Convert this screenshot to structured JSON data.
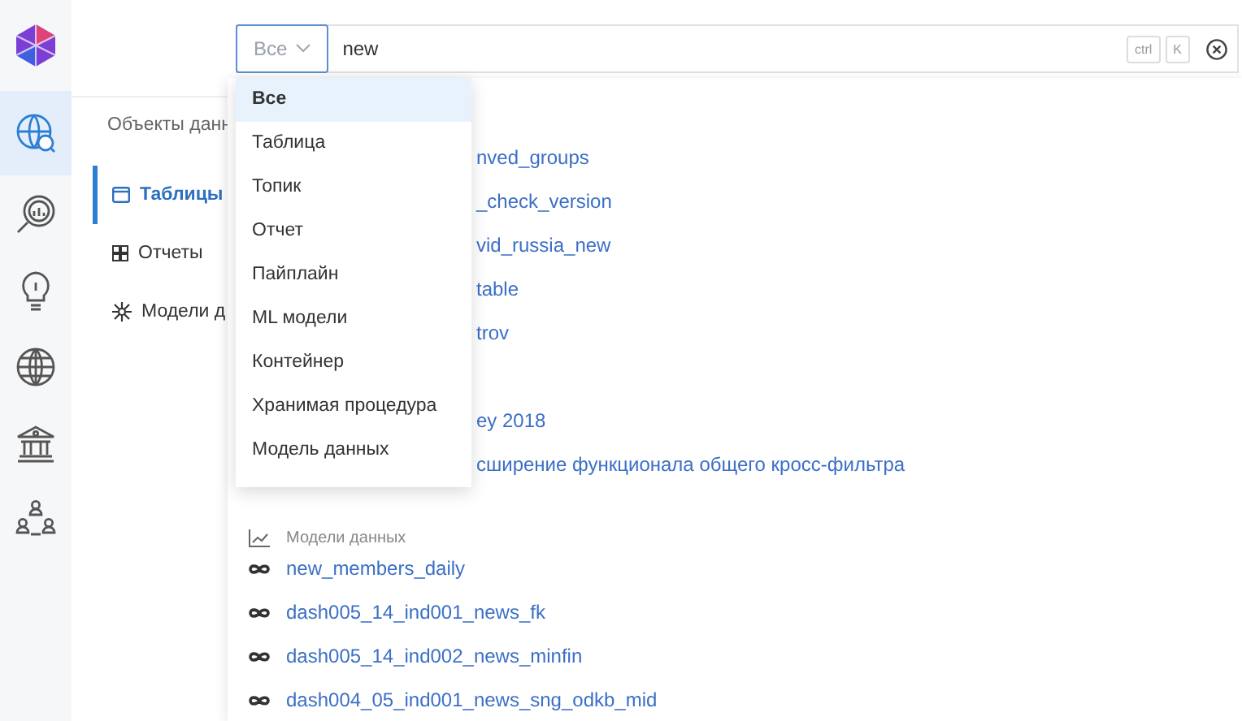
{
  "rail": {
    "items": [
      {
        "kind": "globe-search",
        "selected": true
      },
      {
        "kind": "chart-search",
        "selected": false
      },
      {
        "kind": "bulb",
        "selected": false
      },
      {
        "kind": "globe",
        "selected": false
      },
      {
        "kind": "bank",
        "selected": false
      },
      {
        "kind": "people",
        "selected": false
      }
    ]
  },
  "nav": {
    "title": "Объекты данн",
    "items": [
      {
        "kind": "table",
        "label": "Таблицы",
        "selected": true
      },
      {
        "kind": "report",
        "label": "Отчеты",
        "selected": false
      },
      {
        "kind": "model",
        "label": "Модели д",
        "selected": false
      }
    ]
  },
  "search": {
    "scope": "Все",
    "query": "new",
    "shortcut": [
      "ctrl",
      "K"
    ]
  },
  "scope_menu": [
    {
      "label": "Все",
      "selected": true
    },
    {
      "label": "Таблица",
      "selected": false
    },
    {
      "label": "Топик",
      "selected": false
    },
    {
      "label": "Отчет",
      "selected": false
    },
    {
      "label": "Пайплайн",
      "selected": false
    },
    {
      "label": "ML модели",
      "selected": false
    },
    {
      "label": "Контейнер",
      "selected": false
    },
    {
      "label": "Хранимая процедура",
      "selected": false
    },
    {
      "label": "Модель данных",
      "selected": false
    }
  ],
  "results_behind_menu": [
    [
      "nved_groups",
      "_check_version",
      "vid_russia_new",
      "table",
      "trov"
    ],
    [
      "ey 2018",
      "сширение функционала общего кросс-фильтра"
    ]
  ],
  "result_group": {
    "title": "Модели данных",
    "items": [
      "new_members_daily",
      "dash005_14_ind001_news_fk",
      "dash005_14_ind002_news_minfin",
      "dash004_05_ind001_news_sng_odkb_mid"
    ]
  }
}
